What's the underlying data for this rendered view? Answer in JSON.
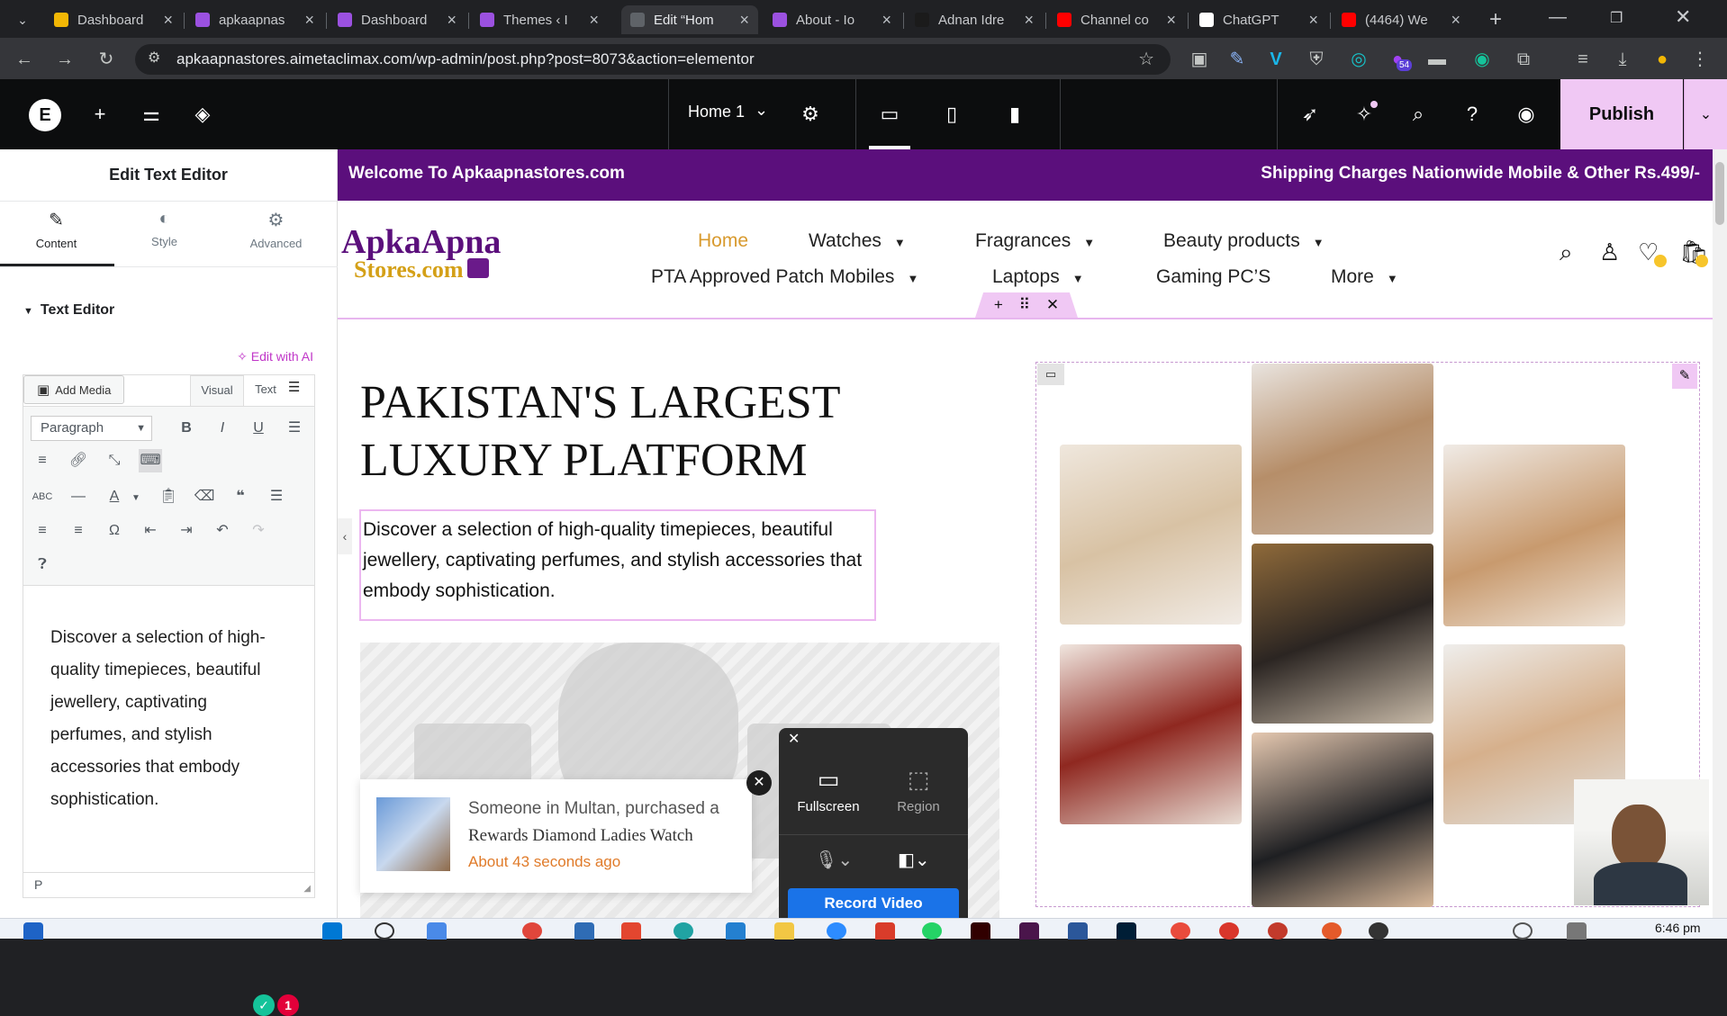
{
  "browser": {
    "tabs": [
      {
        "title": "Dashboard",
        "color": "#f2b705"
      },
      {
        "title": "apkaapnas",
        "color": "#9b51e0"
      },
      {
        "title": "Dashboard",
        "color": "#9b51e0"
      },
      {
        "title": "Themes ‹ I",
        "color": "#9b51e0"
      },
      {
        "title": "Edit “Hom",
        "color": "#5f6368",
        "active": true
      },
      {
        "title": "About - Io",
        "color": "#9b51e0"
      },
      {
        "title": "Adnan Idre",
        "color": "#1b1b1b"
      },
      {
        "title": "Channel co",
        "color": "#ff0000"
      },
      {
        "title": "ChatGPT",
        "color": "#ffffff"
      },
      {
        "title": "(4464) We",
        "color": "#ff0000"
      }
    ],
    "url": "apkaapnastores.aimetaclimax.com/wp-admin/post.php?post=8073&action=elementor",
    "extension_badge": "54"
  },
  "elementor": {
    "page_name": "Home 1",
    "publish_label": "Publish"
  },
  "panel": {
    "title": "Edit Text Editor",
    "tabs": [
      {
        "label": "Content",
        "icon": "pencil-icon"
      },
      {
        "label": "Style",
        "icon": "half-circle-icon"
      },
      {
        "label": "Advanced",
        "icon": "gear-icon"
      }
    ],
    "section_title": "Text Editor",
    "ai_link": "Edit with AI",
    "add_media": "Add Media",
    "tab_visual": "Visual",
    "tab_text": "Text",
    "format_select": "Paragraph",
    "body_text": "Discover a selection of high-quality timepieces, beautiful jewellery, captivating perfumes, and stylish accessories that embody sophistication.",
    "status_path": "P",
    "grammarly_count": "1"
  },
  "site": {
    "topbar_left": "Welcome To Apkaapnastores.com",
    "topbar_right": "Shipping Charges Nationwide Mobile & Other Rs.499/-",
    "logo_line1": "ApkaApna",
    "logo_line2": "Stores.com",
    "nav_row1": [
      "Home",
      "Watches",
      "Fragrances",
      "Beauty products"
    ],
    "nav_row2": [
      "PTA Approved Patch Mobiles",
      "Laptops",
      "Gaming PC’S",
      "More"
    ],
    "hero_title_line1": "PAKISTAN'S LARGEST",
    "hero_title_line2": "LUXURY PLATFORM",
    "hero_text": "Discover a selection of high-quality timepieces, beautiful jewellery, captivating perfumes, and stylish accessories that embody sophistication.",
    "accent_color": "#5b0f7c",
    "highlight_color": "#f0c8f4"
  },
  "notification": {
    "line1": "Someone in Multan, purchased a",
    "line2": "Rewards Diamond Ladies Watch",
    "line3": "About 43 seconds ago"
  },
  "recorder": {
    "fullscreen": "Fullscreen",
    "region": "Region",
    "record": "Record Video"
  },
  "taskbar": {
    "time": "6:46 pm"
  }
}
